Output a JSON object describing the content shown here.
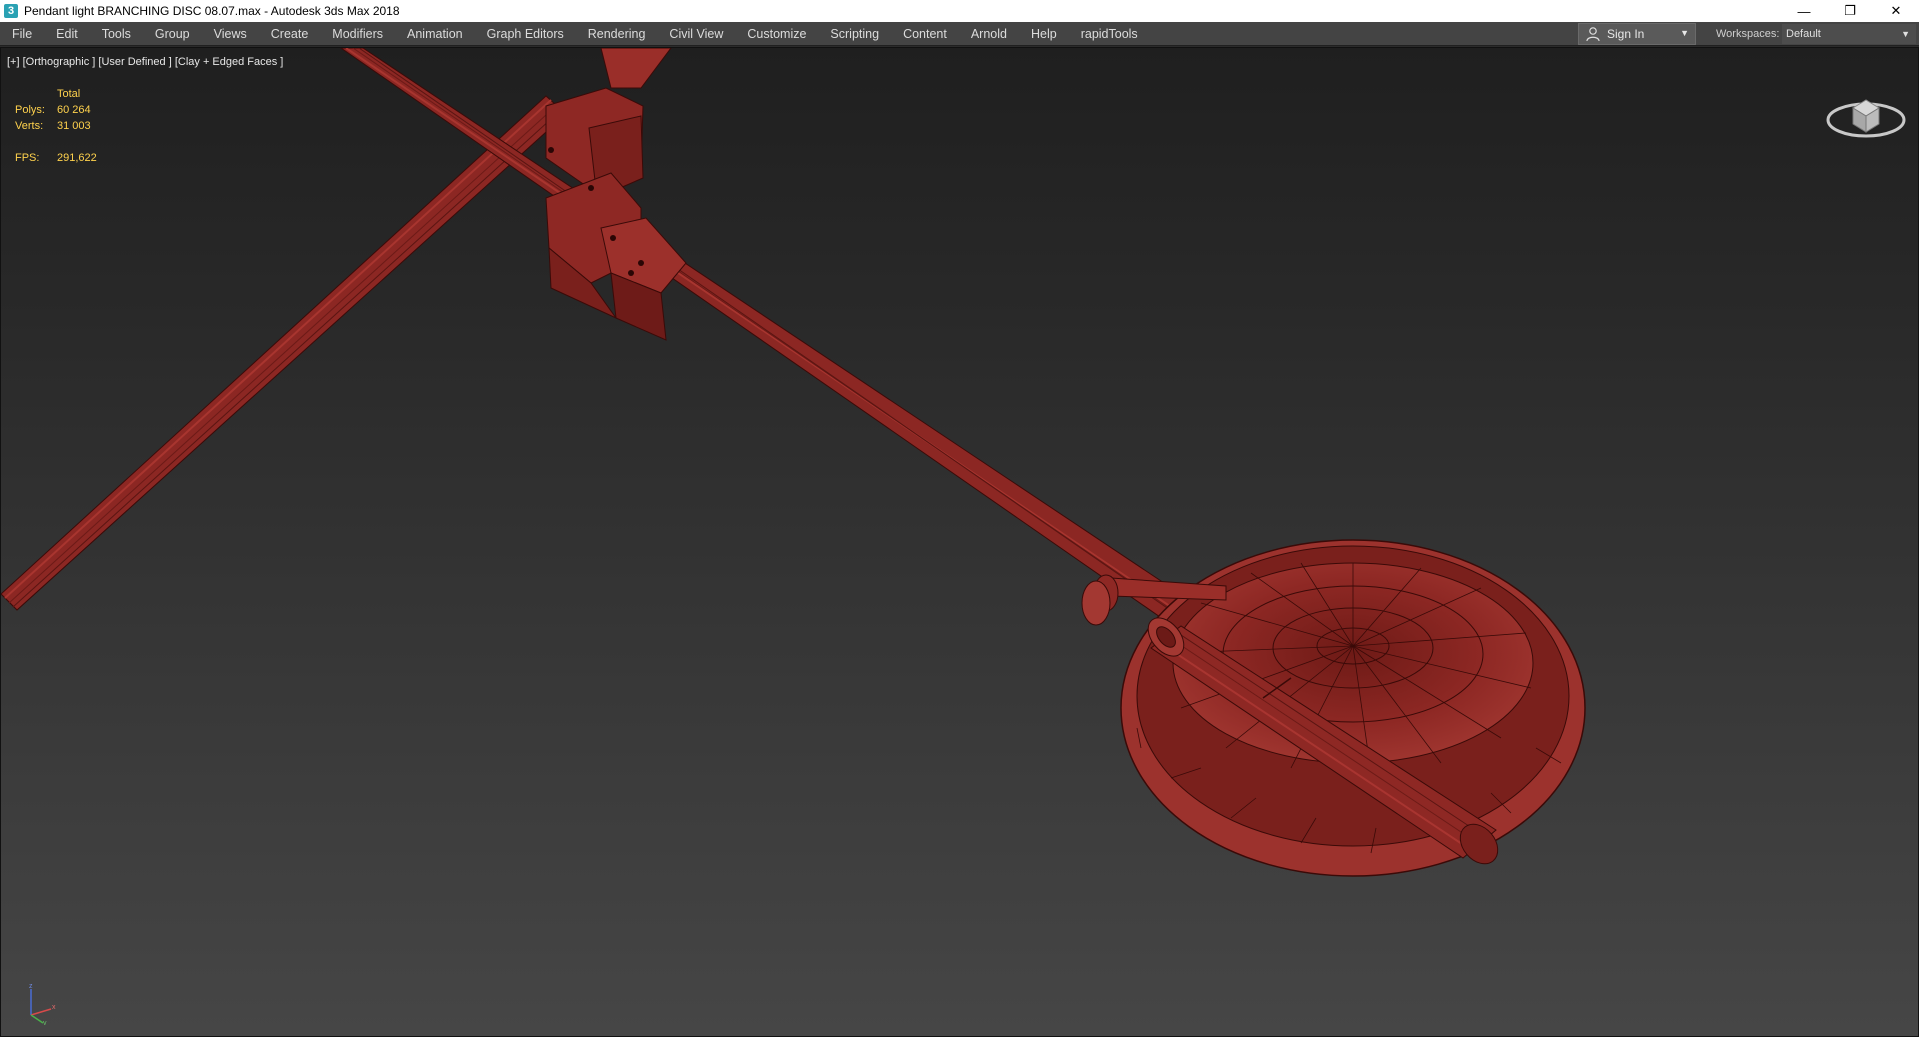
{
  "titlebar": {
    "app_icon": "3ds-max-icon",
    "title": "Pendant light BRANCHING DISC 08.07.max - Autodesk 3ds Max 2018",
    "minimize": "—",
    "restore": "❐",
    "close": "✕"
  },
  "menubar": {
    "items": [
      "File",
      "Edit",
      "Tools",
      "Group",
      "Views",
      "Create",
      "Modifiers",
      "Animation",
      "Graph Editors",
      "Rendering",
      "Civil View",
      "Customize",
      "Scripting",
      "Content",
      "Arnold",
      "Help",
      "rapidTools"
    ],
    "signin_label": "Sign In",
    "workspaces_label": "Workspaces:",
    "workspace_value": "Default"
  },
  "viewport": {
    "label": "[+] [Orthographic ] [User Defined ] [Clay + Edged Faces ]",
    "stats": {
      "header": "Total",
      "polys_label": "Polys:",
      "polys_value": "60 264",
      "verts_label": "Verts:",
      "verts_value": "31 003",
      "fps_label": "FPS:",
      "fps_value": "291,622"
    },
    "colors": {
      "clay": "#8f2a26",
      "clay_dark": "#5e1614",
      "edge": "#3a0a08",
      "stats_text": "#ffd24d"
    }
  }
}
